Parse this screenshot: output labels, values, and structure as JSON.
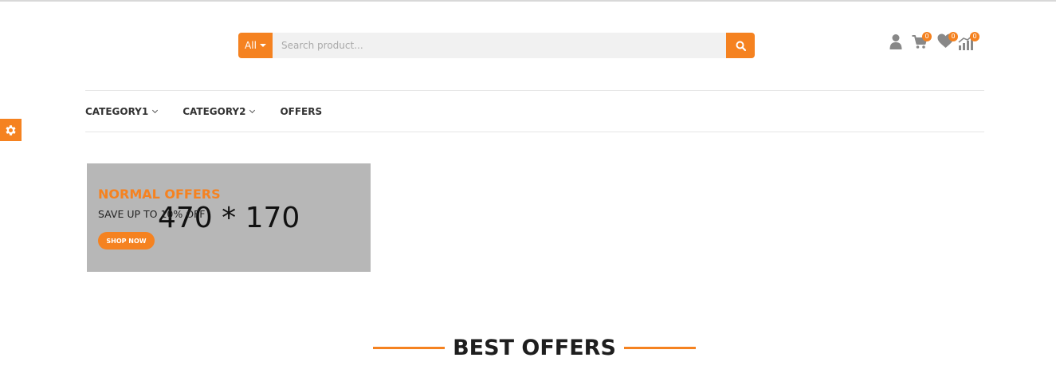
{
  "search": {
    "category_label": "All",
    "placeholder": "Search product...",
    "value": ""
  },
  "header_icons": {
    "account": "user-icon",
    "cart": {
      "icon": "cart-icon",
      "count": "0"
    },
    "wishlist": {
      "icon": "heart-icon",
      "count": "0"
    },
    "compare": {
      "icon": "compare-icon",
      "count": "0"
    }
  },
  "nav": {
    "items": [
      {
        "label": "CATEGORY1",
        "has_dropdown": true
      },
      {
        "label": "CATEGORY2",
        "has_dropdown": true
      },
      {
        "label": "OFFERS",
        "has_dropdown": false
      }
    ]
  },
  "settings_tab": {
    "icon": "gear-icon"
  },
  "banner": {
    "placeholder_text": "470 * 170",
    "title": "NORMAL OFFERS",
    "subtitle": "SAVE UP TO 10% OFF",
    "button_label": "SHOP NOW"
  },
  "section": {
    "heading": "BEST OFFERS"
  },
  "colors": {
    "accent": "#f58220",
    "search_bg": "#f1f1f1",
    "banner_bg": "#b7b7b7",
    "icon_gray": "#888888"
  }
}
